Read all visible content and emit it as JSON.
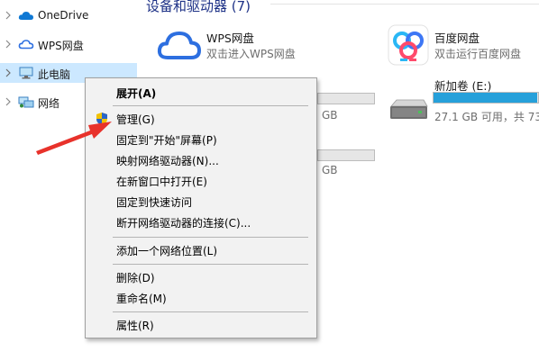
{
  "nav": {
    "items": [
      {
        "label": "OneDrive",
        "icon": "onedrive-cloud-icon"
      },
      {
        "label": "WPS网盘",
        "icon": "wps-cloud-icon"
      },
      {
        "label": "此电脑",
        "icon": "this-pc-icon",
        "selected": true
      },
      {
        "label": "网络",
        "icon": "network-icon"
      }
    ]
  },
  "content": {
    "group_header": "设备和驱动器 (7)",
    "tiles": {
      "wps": {
        "title": "WPS网盘",
        "subtitle": "双击进入WPS网盘"
      },
      "baidu": {
        "title": "百度网盘",
        "subtitle": "双击运行百度网盘"
      },
      "drive_e": {
        "title": "新加卷 (E:)",
        "subtitle": "27.1 GB 可用，共 73",
        "used_fraction": 0.99
      },
      "drive_hidden_1": {
        "subtitle": "GB"
      },
      "drive_hidden_2": {
        "subtitle": "GB"
      }
    },
    "colors": {
      "accent_bar": "#26a0da",
      "selected_bg": "#cce8ff",
      "arrow": "#e8322b"
    }
  },
  "context_menu": {
    "items": [
      {
        "label": "展开(A)",
        "bold": true
      },
      {
        "label": "管理(G)",
        "icon": "uac-shield-icon"
      },
      {
        "label": "固定到\"开始\"屏幕(P)"
      },
      {
        "label": "映射网络驱动器(N)..."
      },
      {
        "label": "在新窗口中打开(E)"
      },
      {
        "label": "固定到快速访问"
      },
      {
        "label": "断开网络驱动器的连接(C)..."
      },
      {
        "label": "添加一个网络位置(L)"
      },
      {
        "label": "删除(D)"
      },
      {
        "label": "重命名(M)"
      },
      {
        "label": "属性(R)"
      }
    ]
  }
}
